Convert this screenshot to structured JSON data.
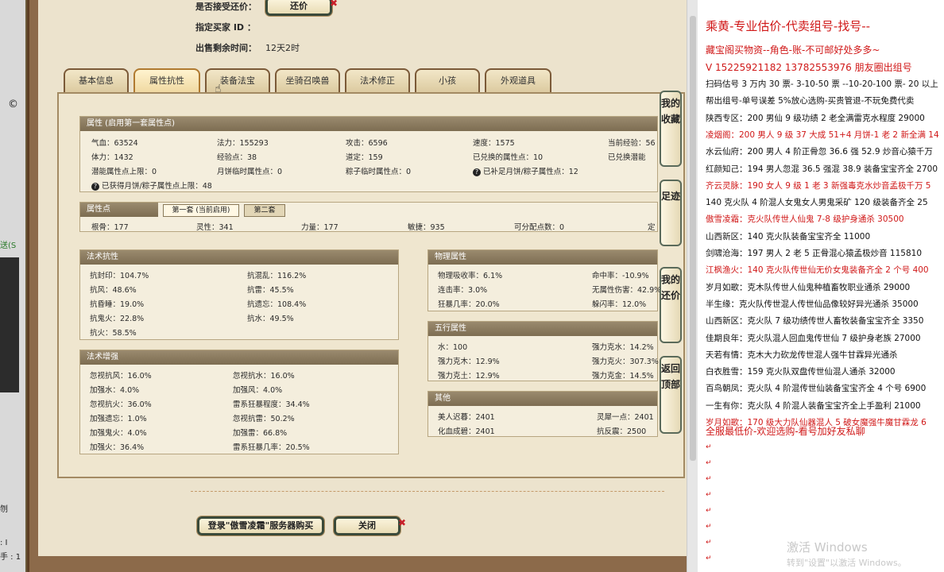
{
  "left_strip": {
    "text1": "送(S",
    "text2": "©",
    "text3": "刎",
    "text4": ": I",
    "text5": "手 : 1"
  },
  "top_info": {
    "accept_counter_label": "是否接受还价：",
    "counter_btn": "还价",
    "buyer_id_label": "指定买家 ID ：",
    "remaining_label": "出售剩余时间：",
    "remaining_value": "12天2时"
  },
  "tabs": [
    "基本信息",
    "属性抗性",
    "装备法宝",
    "坐骑召唤兽",
    "法术修正",
    "小孩",
    "外观道具"
  ],
  "active_tab": "属性抗性",
  "attributes": {
    "header": "属性 (启用第一套属性点)",
    "rows": [
      [
        "气血：63524",
        "法力：155293",
        "攻击：6596",
        "速度：1575",
        "当前经验：56"
      ],
      [
        "体力：1432",
        "经验点：38",
        "道定：159",
        "已兑换的属性点：10",
        "已兑换潜能"
      ],
      [
        "潜能属性点上限：0",
        "月饼临时属性点：0",
        "粽子临时属性点：0",
        "已补足月饼/粽子属性点：12",
        ""
      ]
    ],
    "last": "已获得月饼/粽子属性点上限：48"
  },
  "points": {
    "header": "属性点",
    "tab1": "第一套 (当前启用)",
    "tab2": "第二套",
    "items": [
      "根骨：177",
      "灵性：341",
      "力量：177",
      "敏捷：935",
      "可分配点数：0",
      "定"
    ]
  },
  "spell_resist": {
    "header": "法术抗性",
    "left": [
      "抗封印：104.7%",
      "抗风：48.6%",
      "抗昏睡：19.0%",
      "抗鬼火：22.8%",
      "抗火：58.5%"
    ],
    "right": [
      "抗混乱：116.2%",
      "抗雷：45.5%",
      "抗遗忘：108.4%",
      "抗水：49.5%"
    ]
  },
  "spell_enhance": {
    "header": "法术增强",
    "left": [
      "忽视抗风：16.0%",
      "加强水：4.0%",
      "忽视抗火：36.0%",
      "加强遗忘：1.0%",
      "加强鬼火：4.0%",
      "加强火：36.4%"
    ],
    "right": [
      "忽视抗水：16.0%",
      "加强风：4.0%",
      "雷系狂暴程度：34.4%",
      "忽视抗雷：50.2%",
      "加强雷：66.8%",
      "雷系狂暴几率：20.5%"
    ]
  },
  "physical": {
    "header": "物理属性",
    "left": [
      "物理吸收率：6.1%",
      "连击率：3.0%",
      "狂暴几率：20.0%"
    ],
    "right": [
      "命中率：-10.9%",
      "无属性伤害：42.9%",
      "躲闪率：12.0%"
    ]
  },
  "elements": {
    "header": "五行属性",
    "left": [
      "水：100",
      "强力克木：12.9%",
      "强力克土：12.9%"
    ],
    "right": [
      "强力克水：14.2%",
      "强力克火：307.3%",
      "强力克金：14.5%"
    ]
  },
  "other": {
    "header": "其他",
    "left": [
      "美人迟暮：2401",
      "化血成碧：2401"
    ],
    "right": [
      "灵犀一点：2401",
      "抗反震：2500"
    ]
  },
  "side_buttons": [
    "我的收藏",
    "足迹",
    "我的还价",
    "返回顶部"
  ],
  "bottom": {
    "buy_btn": "登录\"傲雪凌霜\"服务器购买",
    "close_btn": "关闭"
  },
  "doc": {
    "title": "乘黄-专业估价-代卖组号-找号--",
    "line2": "藏宝阁买物资--角色-账-不可邮好处多多~",
    "line3": "V 15225921182   13782553976 朋友圈出组号",
    "lines": [
      {
        "t": "扫码估号 3 万内 30 票- 3-10-50 票  --10-20-100 票- 20 以上",
        "c": "k"
      },
      {
        "t": "帮出组号-单号误差 5%放心选购-买贵管退-不玩免费代卖",
        "c": "k"
      },
      {
        "t": "陕西专区：200 男仙 9 级功绩 2 老全满雷克水程度 29000",
        "c": "k"
      },
      {
        "t": "凌烟阁：200 男人 9 级 37 大成 51+4 月饼-1 老 2 新全满 14",
        "c": "r"
      },
      {
        "t": "水云仙府：200 男人 4 阶正骨忽 36.6 强 52.9 炒音心猿千万",
        "c": "k"
      },
      {
        "t": "红颜知己：194 男人忽混 36.5 强混 38.9 装备宝宝齐全 2700",
        "c": "k"
      },
      {
        "t": "齐云灵脉：190 女人 9 级 1 老 3 新强毒克水炒音孟极千万 5",
        "c": "r"
      },
      {
        "t": "140 克火队 4 阶混人女鬼女人男鬼采矿 120 级装备齐全 25",
        "c": "k"
      },
      {
        "t": "傲雪凌霜：克火队传世人仙鬼 7-8 级护身通杀 30500",
        "c": "r"
      },
      {
        "t": "山西新区：140 克火队装备宝宝齐全 11000",
        "c": "k"
      },
      {
        "t": "剑啸沧海：197 男人 2 老 5 正骨混心猿孟极炒音 115810",
        "c": "k"
      },
      {
        "t": "江枫渔火：140 克火队传世仙无价女鬼装备齐全 2 个号 400",
        "c": "r"
      },
      {
        "t": "岁月如歌：克木队传世人仙鬼种植畜牧职业通杀 29000",
        "c": "k"
      },
      {
        "t": "半生缘：克火队传世混人传世仙品像较好异光通杀 35000",
        "c": "k"
      },
      {
        "t": "山西新区：克火队 7 级功绩传世人畜牧装备宝宝齐全 3350",
        "c": "k"
      },
      {
        "t": "佳期良年：克火队混人回血鬼传世仙 7 级护身老族 27000",
        "c": "k"
      },
      {
        "t": "天若有情：克木大力砍龙传世混人强牛甘霖异光通杀",
        "c": "k"
      },
      {
        "t": "白衣胜雪：159 克火队双盘传世仙混人通杀 32000",
        "c": "k"
      },
      {
        "t": "百鸟朝凤：克火队 4 阶混传世仙装备宝宝齐全 4 个号 6900",
        "c": "k"
      },
      {
        "t": "一生有你：克火队 4 阶混人装备宝宝齐全上手盈利 21000",
        "c": "k"
      },
      {
        "t": "岁月如歌：170 级大力队仙器混人 5 破女魔强牛魔甘霖龙 6",
        "c": "r"
      }
    ],
    "footer": "全服最低价-欢迎选购-看号加好友私聊",
    "watermark1": "激活 Windows",
    "watermark2": "转到\"设置\"以激活 Windows。"
  }
}
